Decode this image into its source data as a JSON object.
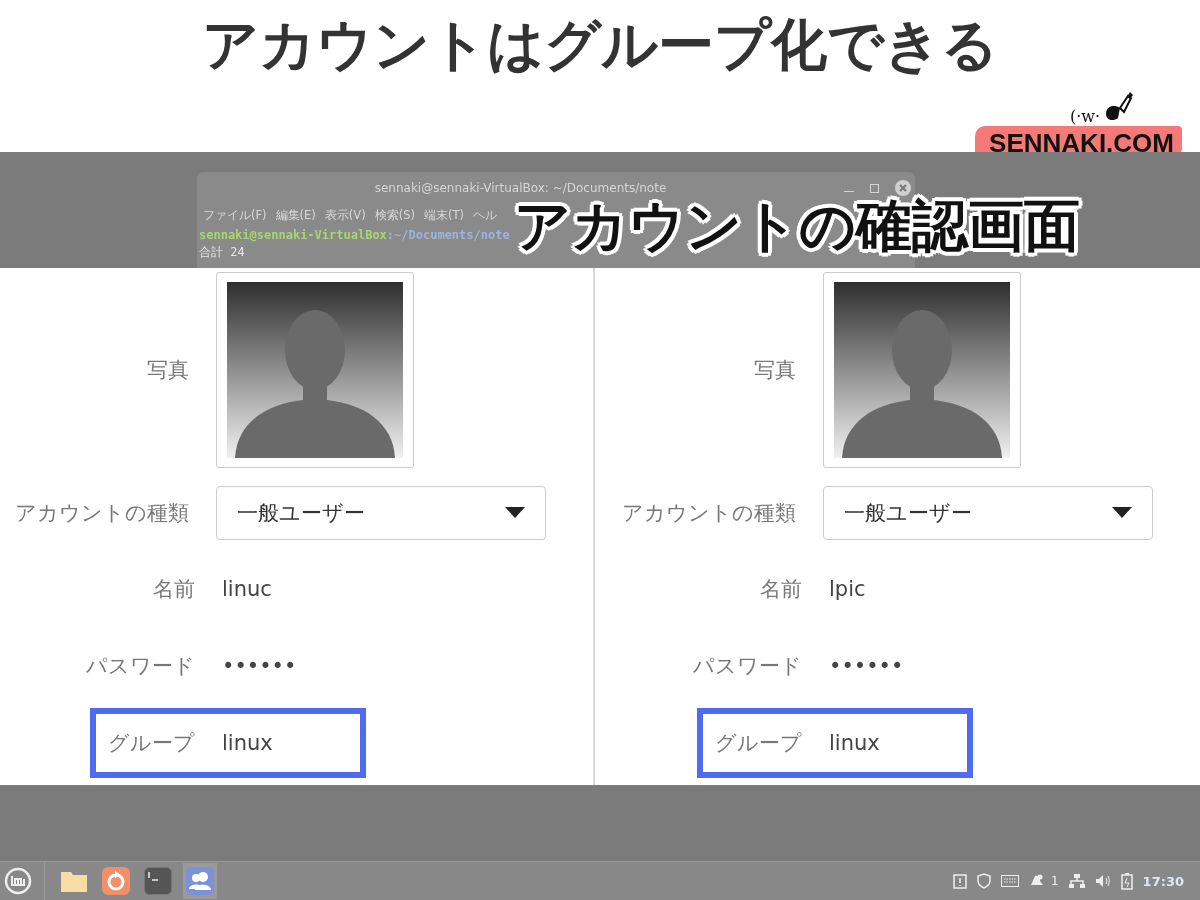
{
  "header": {
    "title": "アカウントはグループ化できる",
    "logo": {
      "face": "(·w·",
      "name": "SENNAKI.COM"
    }
  },
  "overlay_title": "アカウントの確認画面",
  "terminal": {
    "title": "sennaki@sennaki-VirtualBox: ~/Documents/note",
    "menu": [
      "ファイル(F)",
      "編集(E)",
      "表示(V)",
      "検索(S)",
      "端末(T)",
      "ヘル"
    ],
    "prompt": {
      "user": "sennaki@sennaki-VirtualBox",
      "path": ":~/Documents/note"
    },
    "lines": [
      "合計 24"
    ]
  },
  "accounts": [
    {
      "photo_label": "写真",
      "type_label": "アカウントの種類",
      "type": "一般ユーザー",
      "fields": [
        {
          "label": "名前",
          "value": "linuc",
          "highlighted": false
        },
        {
          "label": "パスワード",
          "value": "••••••",
          "highlighted": false
        },
        {
          "label": "グループ",
          "value": "linux",
          "highlighted": true
        }
      ]
    },
    {
      "photo_label": "写真",
      "type_label": "アカウントの種類",
      "type": "一般ユーザー",
      "fields": [
        {
          "label": "名前",
          "value": "lpic",
          "highlighted": false
        },
        {
          "label": "パスワード",
          "value": "••••••",
          "highlighted": false
        },
        {
          "label": "グループ",
          "value": "linux",
          "highlighted": true
        }
      ]
    }
  ],
  "taskbar": {
    "launchers": [
      {
        "kind": "folder",
        "selected": false
      },
      {
        "kind": "update",
        "selected": false
      },
      {
        "kind": "terminal",
        "selected": false
      },
      {
        "kind": "users",
        "selected": true
      }
    ],
    "notifications": "1",
    "clock": "17:30"
  }
}
